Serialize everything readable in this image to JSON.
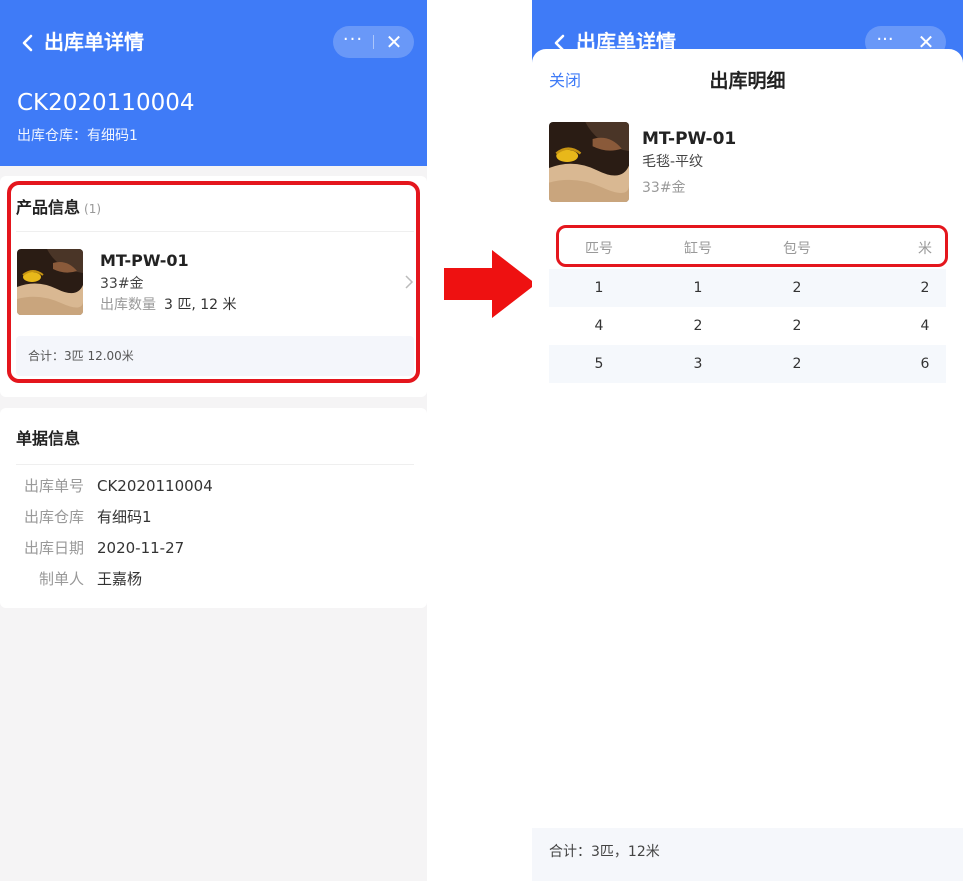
{
  "left": {
    "nav": {
      "title": "出库单详情",
      "more": "···",
      "close": "✕"
    },
    "header": {
      "order_no": "CK2020110004",
      "warehouse_line": "出库仓库：有细码1"
    },
    "product_section": {
      "title": "产品信息",
      "count": "(1)",
      "item": {
        "name": "MT-PW-01",
        "color": "33#金",
        "qty_label": "出库数量",
        "qty_value": "3 匹, 12 米"
      },
      "total": "合计：3匹 12.00米"
    },
    "doc_section": {
      "title": "单据信息",
      "rows": [
        {
          "label": "出库单号",
          "value": "CK2020110004"
        },
        {
          "label": "出库仓库",
          "value": "有细码1"
        },
        {
          "label": "出库日期",
          "value": "2020-11-27"
        },
        {
          "label": "制单人",
          "value": "王嘉杨"
        }
      ]
    }
  },
  "right": {
    "nav": {
      "title": "出库单详情",
      "more": "···",
      "close": "✕"
    },
    "sheet": {
      "close_label": "关闭",
      "title": "出库明细",
      "product": {
        "name": "MT-PW-01",
        "category": "毛毯-平纹",
        "color": "33#金"
      },
      "table": {
        "headers": [
          "匹号",
          "缸号",
          "包号",
          "米"
        ],
        "rows": [
          [
            "1",
            "1",
            "2",
            "2"
          ],
          [
            "4",
            "2",
            "2",
            "4"
          ],
          [
            "5",
            "3",
            "2",
            "6"
          ]
        ]
      },
      "footer": "合计：3匹，12米"
    }
  },
  "colors": {
    "primary": "#3f7bf7",
    "highlight": "#e4161d",
    "arrow": "#ee1111"
  },
  "icons": [
    "back-arrow-icon",
    "more-icon",
    "close-icon",
    "chevron-right-icon",
    "direction-arrow-icon"
  ]
}
